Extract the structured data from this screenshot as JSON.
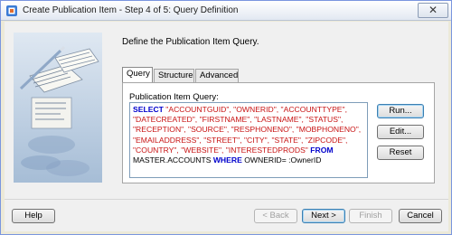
{
  "window": {
    "title": "Create Publication Item - Step 4 of 5: Query Definition",
    "close_label": "✕"
  },
  "intro": "Define the Publication Item Query.",
  "tabs": [
    {
      "label": "Query",
      "active": true
    },
    {
      "label": "Structure",
      "active": false
    },
    {
      "label": "Advanced",
      "active": false
    }
  ],
  "query_label": "Publication Item Query:",
  "query_lines": [
    [
      {
        "t": "SELECT",
        "k": "kw"
      },
      {
        "t": " \"ACCOUNTGUID\", \"OWNERID\", \"ACCOUNTTYPE\",",
        "k": "str"
      }
    ],
    [
      {
        "t": "\"DATECREATED\", \"FIRSTNAME\", \"LASTNAME\", \"STATUS\",",
        "k": "str"
      }
    ],
    [
      {
        "t": "\"RECEPTION\", \"SOURCE\", \"RESPHONENO\", \"MOBPHONENO\",",
        "k": "str"
      }
    ],
    [
      {
        "t": "\"EMAILADDRESS\", \"STREET\", \"CITY\", \"STATE\", \"ZIPCODE\",",
        "k": "str"
      }
    ],
    [
      {
        "t": "\"COUNTRY\", \"WEBSITE\", \"INTERESTEDPRODS\" ",
        "k": "str"
      },
      {
        "t": "FROM",
        "k": "kw"
      }
    ],
    [
      {
        "t": "MASTER.ACCOUNTS ",
        "k": "plain"
      },
      {
        "t": "WHERE",
        "k": "kw"
      },
      {
        "t": " OWNERID= :OwnerID",
        "k": "plain"
      }
    ]
  ],
  "side_buttons": {
    "run": "Run...",
    "edit": "Edit...",
    "reset": "Reset"
  },
  "footer": {
    "help": "Help",
    "back": "< Back",
    "next": "Next >",
    "finish": "Finish",
    "cancel": "Cancel"
  },
  "colors": {
    "keyword": "#0000cc",
    "string": "#c81414",
    "window_bg": "#f0f0f0"
  }
}
